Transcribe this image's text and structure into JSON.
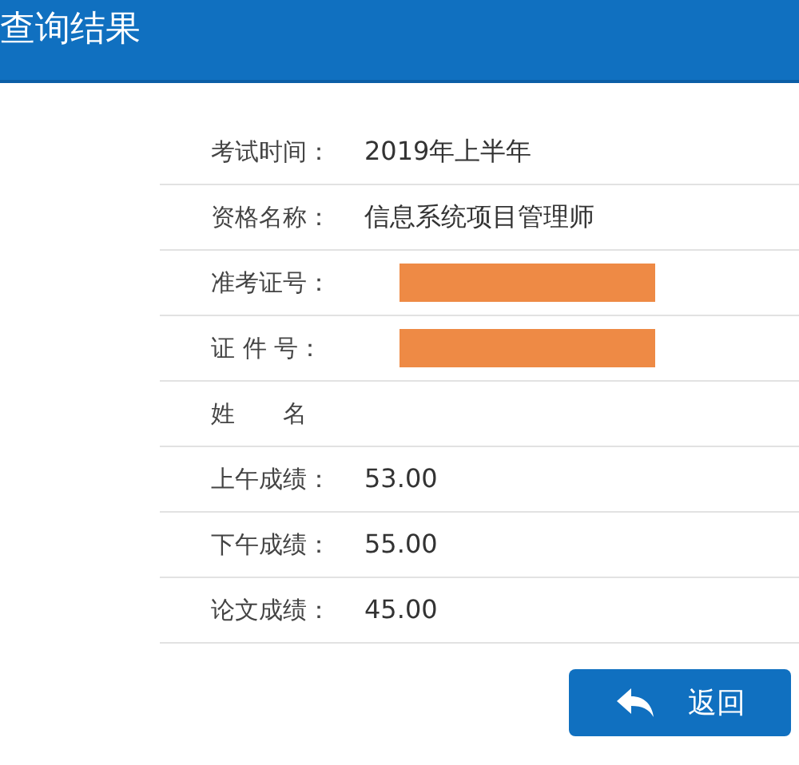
{
  "header": {
    "title": "查询结果"
  },
  "rows": [
    {
      "label": "考试时间：",
      "value": "2019年上半年",
      "redacted": false
    },
    {
      "label": "资格名称：",
      "value": "信息系统项目管理师",
      "redacted": false
    },
    {
      "label": "准考证号：",
      "redacted": true
    },
    {
      "label": "证 件 号：",
      "redacted": true
    },
    {
      "label": "姓　　名",
      "redacted": false
    },
    {
      "label": "上午成绩：",
      "value": "53.00",
      "redacted": false
    },
    {
      "label": "下午成绩：",
      "value": "55.00",
      "redacted": false
    },
    {
      "label": "论文成绩：",
      "value": "45.00",
      "redacted": false
    }
  ],
  "back_button": {
    "label": "返回"
  }
}
